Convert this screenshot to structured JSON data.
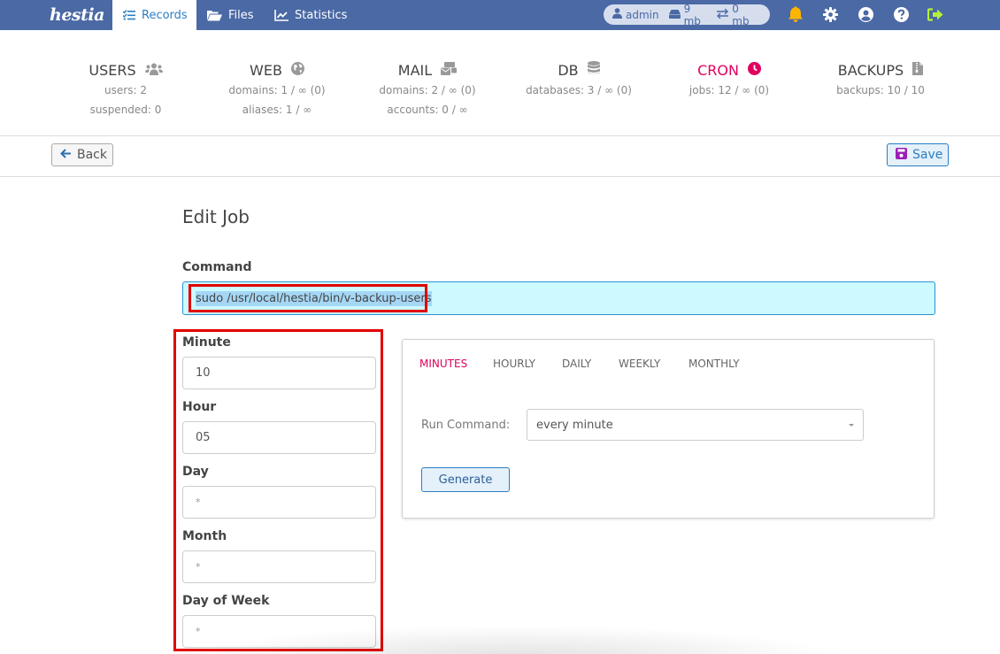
{
  "app": {
    "logo_text": "hestia"
  },
  "nav": {
    "items": [
      {
        "label": "Records",
        "icon": "records-list-icon",
        "active": true
      },
      {
        "label": "Files",
        "icon": "folder-open-icon",
        "active": false
      },
      {
        "label": "Statistics",
        "icon": "chart-line-icon",
        "active": false
      }
    ]
  },
  "user_bar": {
    "username": "admin",
    "disk": "9 mb",
    "bandwidth": "0 mb",
    "icons": [
      "notifications-bell-icon",
      "settings-gear-icon",
      "user-account-icon",
      "help-icon",
      "logout-icon"
    ]
  },
  "stats": [
    {
      "title": "USERS",
      "icon": "users-icon",
      "lines": [
        "users: 2",
        "suspended: 0"
      ],
      "active": false
    },
    {
      "title": "WEB",
      "icon": "globe-icon",
      "lines": [
        "domains: 1 / ∞ (0)",
        "aliases: 1 / ∞"
      ],
      "active": false
    },
    {
      "title": "MAIL",
      "icon": "mail-icon",
      "lines": [
        "domains: 2 / ∞ (0)",
        "accounts: 0 / ∞"
      ],
      "active": false
    },
    {
      "title": "DB",
      "icon": "database-icon",
      "lines": [
        "databases: 3 / ∞ (0)"
      ],
      "active": false
    },
    {
      "title": "CRON",
      "icon": "clock-icon",
      "lines": [
        "jobs: 12 / ∞ (0)"
      ],
      "active": true
    },
    {
      "title": "BACKUPS",
      "icon": "file-archive-icon",
      "lines": [
        "backups: 10 / 10"
      ],
      "active": false
    }
  ],
  "toolbar": {
    "back_label": "Back",
    "save_label": "Save"
  },
  "form": {
    "title": "Edit Job",
    "command_label": "Command",
    "command_value": "sudo /usr/local/hestia/bin/v-backup-users",
    "fields": [
      {
        "label": "Minute",
        "value": "10"
      },
      {
        "label": "Hour",
        "value": "05"
      },
      {
        "label": "Day",
        "value": "*"
      },
      {
        "label": "Month",
        "value": "*"
      },
      {
        "label": "Day of Week",
        "value": "*"
      }
    ]
  },
  "generator": {
    "tabs": [
      "MINUTES",
      "HOURLY",
      "DAILY",
      "WEEKLY",
      "MONTHLY"
    ],
    "active_tab": "MINUTES",
    "run_label": "Run Command:",
    "run_value": "every minute",
    "generate_label": "Generate"
  },
  "colors": {
    "nav_bg": "#4a69a5",
    "accent": "#e0005f",
    "link": "#2c7dc4",
    "highlight": "#e10000"
  }
}
